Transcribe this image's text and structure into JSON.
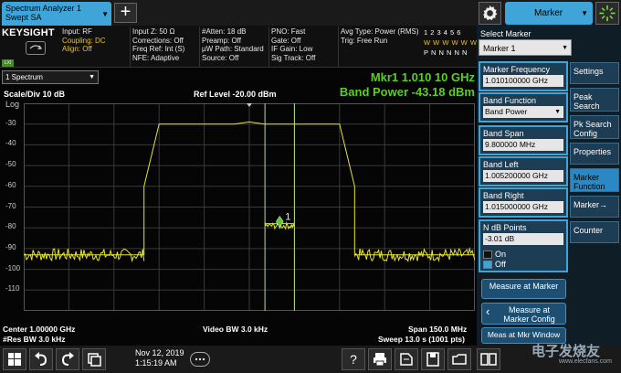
{
  "header": {
    "app_tab_line1": "Spectrum Analyzer 1",
    "app_tab_line2": "Swept SA",
    "add_tab": "+",
    "panel_select": "Marker"
  },
  "info": {
    "brand": "KEYSIGHT",
    "lxi": "LXI",
    "col1": [
      "Input: RF",
      "Coupling: DC",
      "Align: Off"
    ],
    "col2": [
      "Input Z: 50 Ω",
      "Corrections: Off",
      "Freq Ref: Int (S)",
      "NFE: Adaptive"
    ],
    "col3": [
      "#Atten: 18 dB",
      "Preamp: Off",
      "µW Path: Standard",
      "Source: Off"
    ],
    "col4": [
      "PNO: Fast",
      "Gate: Off",
      "IF Gain: Low",
      "Sig Track: Off"
    ],
    "col5": [
      "Avg Type: Power (RMS)",
      "Trig: Free Run"
    ],
    "trace_row1": "1 2 3 4 5 6",
    "trace_row2": "W W W W W W",
    "trace_row3": "P N N N N N"
  },
  "plot": {
    "view": "1 Spectrum",
    "marker_readout": "Mkr1  1.010 10 GHz",
    "band_power": "Band Power -43.18 dBm",
    "scale": "Scale/Div 10 dB",
    "ref_level": "Ref Level -20.00 dBm",
    "log_label": "Log",
    "y_ticks": [
      "-30",
      "-40",
      "-50",
      "-60",
      "-70",
      "-80",
      "-90",
      "-100",
      "-110"
    ],
    "marker_number": "1",
    "center": "Center 1.00000 GHz",
    "res_bw": "#Res BW 3.0 kHz",
    "video_bw": "Video BW 3.0 kHz",
    "span": "Span 150.0 MHz",
    "sweep": "Sweep 13.0 s (1001 pts)"
  },
  "panel": {
    "select_marker_label": "Select Marker",
    "select_marker_value": "Marker 1",
    "marker_freq_label": "Marker Frequency",
    "marker_freq_value": "1.010100000 GHz",
    "band_function_label": "Band Function",
    "band_function_value": "Band Power",
    "band_span_label": "Band Span",
    "band_span_value": "9.800000 MHz",
    "band_left_label": "Band Left",
    "band_left_value": "1.005200000 GHz",
    "band_right_label": "Band Right",
    "band_right_value": "1.015000000 GHz",
    "ndb_label": "N dB Points",
    "ndb_value": "-3.01 dB",
    "ndb_on": "On",
    "ndb_off": "Off",
    "measure_at_marker": "Measure at Marker",
    "measure_at_marker_config": "Measure at Marker Config",
    "meas_at_mkr_window": "Meas at Mkr Window",
    "side_buttons": [
      "Settings",
      "Peak Search",
      "Pk Search Config",
      "Properties",
      "Marker Function",
      "Marker→",
      "Counter"
    ]
  },
  "taskbar": {
    "date": "Nov 12, 2019",
    "time": "1:15:19 AM",
    "watermark": "电子发烧友",
    "watermark_sub": "www.elecfans.com"
  },
  "colors": {
    "accent": "#3fa4d8",
    "trace": "#e6e632",
    "marker_text": "#5ccc2a",
    "band_lines": "#b8e08a",
    "grid": "#3a3a3a"
  },
  "chart_data": {
    "type": "line",
    "xlabel": "",
    "ylabel": "",
    "x_range_GHz": [
      0.925,
      1.075
    ],
    "ylim": [
      -120,
      -20
    ],
    "y_unit": "dBm",
    "series": [
      {
        "x": [
          0.925,
          0.965,
          0.965,
          0.97,
          0.97,
          0.995,
          0.995,
          1.0,
          1.0,
          1.005,
          1.005,
          1.03,
          1.03,
          1.035,
          1.035,
          1.075
        ],
        "values": [
          -93,
          -93,
          -60,
          -30,
          -30,
          -30,
          -30,
          -29,
          -29,
          -30,
          -30,
          -30,
          -30,
          -60,
          -93,
          -93
        ]
      }
    ],
    "band_edges_GHz": [
      1.0052,
      1.015
    ],
    "marker_GHz": 1.0101,
    "marker_dBm": -77
  }
}
